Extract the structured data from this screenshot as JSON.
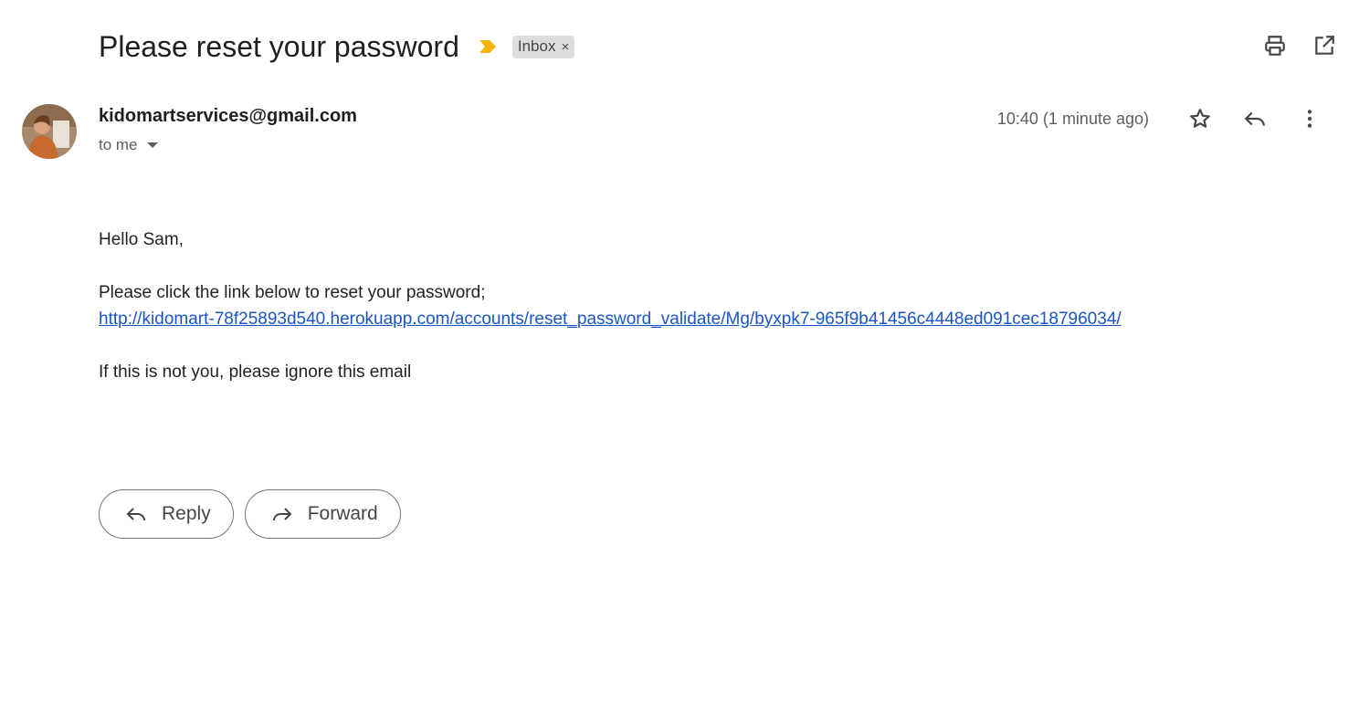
{
  "email": {
    "subject": "Please reset your password",
    "label": "Inbox",
    "label_close": "×",
    "sender": "kidomartservices@gmail.com",
    "recipient": "to me",
    "time": "10:40 (1 minute ago)",
    "body": {
      "greeting": "Hello Sam,",
      "instruction": "Please click the link below to reset your password;",
      "link": "http://kidomart-78f25893d540.herokuapp.com/accounts/reset_password_validate/Mg/byxpk7-965f9b41456c4448ed091cec18796034/",
      "closing": "If this is not you, please ignore this email"
    }
  },
  "actions": {
    "reply": "Reply",
    "forward": "Forward"
  },
  "icons": {
    "importance": "importance-marker-icon",
    "print": "print-icon",
    "open_new_window": "open-in-new-window-icon",
    "star": "star-icon",
    "reply": "reply-icon",
    "more": "more-vertical-icon",
    "forward": "forward-icon"
  },
  "colors": {
    "importance": "#f4b400",
    "link": "#1a55c8",
    "label_bg": "#dddddd"
  }
}
